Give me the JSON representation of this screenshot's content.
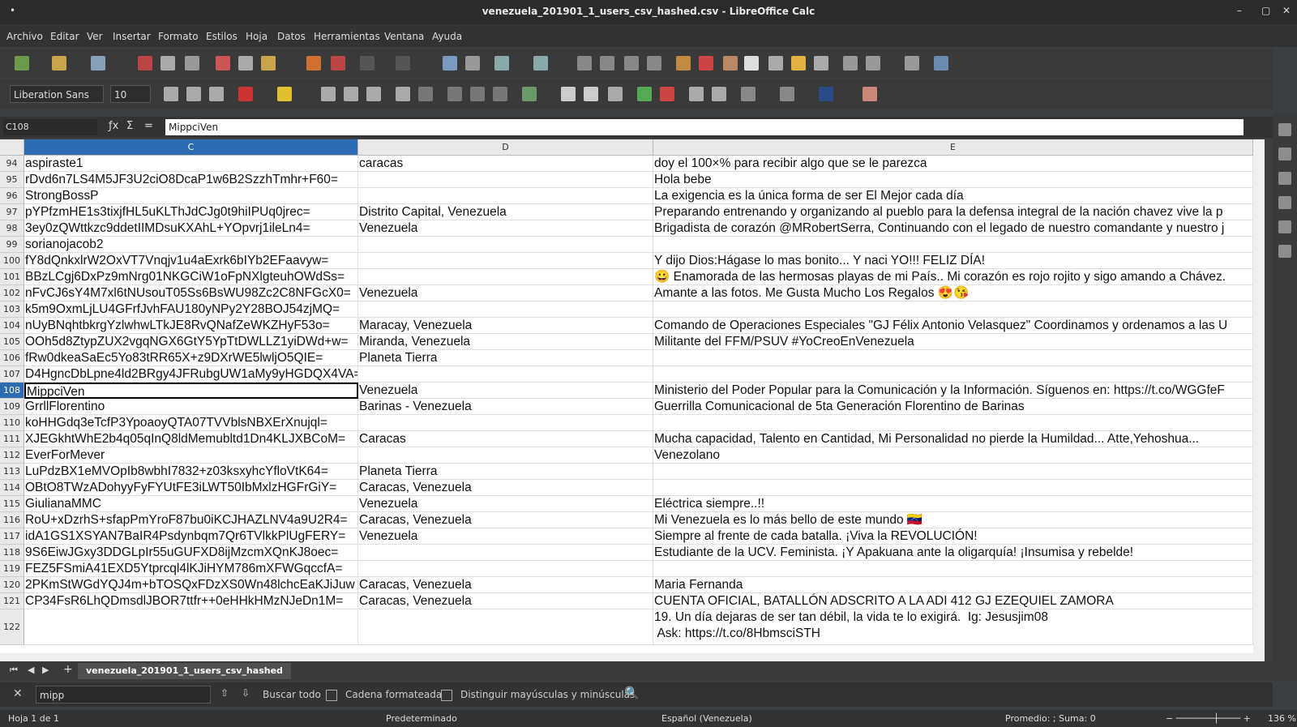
{
  "window": {
    "title": "venezuela_201901_1_users_csv_hashed.csv - LibreOffice Calc"
  },
  "menu": [
    "Archivo",
    "Editar",
    "Ver",
    "Insertar",
    "Formato",
    "Estilos",
    "Hoja",
    "Datos",
    "Herramientas",
    "Ventana",
    "Ayuda"
  ],
  "toolbar": {
    "font_name": "Liberation Sans",
    "font_size": "10"
  },
  "formula_bar": {
    "cell_ref": "C108",
    "content": "MippciVen"
  },
  "columns": {
    "c": "C",
    "d": "D",
    "e": "E"
  },
  "rows": [
    {
      "num": "94",
      "c": "aspiraste1",
      "d": "caracas",
      "e": "doy el 100×% para recibir algo que se le parezca"
    },
    {
      "num": "95",
      "c": "rDvd6n7LS4M5JF3U2ciO8DcaP1w6B2SzzhTmhr+F60=",
      "d": "",
      "e": "Hola bebe"
    },
    {
      "num": "96",
      "c": "StrongBossP",
      "d": "",
      "e": "La exigencia es la única forma de ser El Mejor cada día"
    },
    {
      "num": "97",
      "c": "pYPfzmHE1s3tixjfHL5uKLThJdCJg0t9hiIPUq0jrec=",
      "d": "Distrito Capital, Venezuela",
      "e": "Preparando entrenando y organizando al pueblo para la defensa integral de la nación chavez vive la p"
    },
    {
      "num": "98",
      "c": "3ey0zQWttkzc9ddetIIMDsuKXAhL+YOpvrj1ileLn4=",
      "d": "Venezuela",
      "e": "Brigadista de corazón @MRobertSerra, Continuando con el legado de nuestro comandante y nuestro j"
    },
    {
      "num": "99",
      "c": "sorianojacob2",
      "d": "",
      "e": ""
    },
    {
      "num": "100",
      "c": "fY8dQnkxlrW2OxVT7Vnqjv1u4aExrk6bIYb2EFaavyw=",
      "d": "",
      "e": "Y dijo Dios:Hágase lo mas bonito... Y naci YO!!! FELIZ DÍA!"
    },
    {
      "num": "101",
      "c": "BBzLCgj6DxPz9mNrg01NKGCiW1oFpNXlgteuhOWdSs=",
      "d": "",
      "e": "😀 Enamorada de las hermosas playas de mi País.. Mi corazón es rojo rojito y sigo amando a Chávez."
    },
    {
      "num": "102",
      "c": "nFvCJ6sY4M7xl6tNUsouT05Ss6BsWU98Zc2C8NFGcX0=",
      "d": "Venezuela",
      "e": "Amante a las fotos. Me Gusta Mucho Los Regalos 😍😘"
    },
    {
      "num": "103",
      "c": "k5m9OxmLjLU4GFrfJvhFAU180yNPy2Y28BOJ54zjMQ=",
      "d": "",
      "e": ""
    },
    {
      "num": "104",
      "c": "nUyBNqhtbkrgYzlwhwLTkJE8RvQNafZeWKZHyF53o=",
      "d": "Maracay, Venezuela",
      "e": "Comando de Operaciones Especiales \"GJ Félix Antonio Velasquez\" Coordinamos y ordenamos a las U"
    },
    {
      "num": "105",
      "c": "OOh5d8ZtypZUX2vgqNGX6GtY5YpTtDWLLZ1yiDWd+w=",
      "d": "Miranda, Venezuela",
      "e": "Militante del FFM/PSUV #YoCreoEnVenezuela"
    },
    {
      "num": "106",
      "c": "fRw0dkeaSaEc5Yo83tRR65X+z9DXrWE5lwljO5QIE=",
      "d": "Planeta Tierra",
      "e": ""
    },
    {
      "num": "107",
      "c": "D4HgncDbLpne4ld2BRgy4JFRubgUW1aMy9yHGDQX4VA=",
      "d": "",
      "e": ""
    },
    {
      "num": "108",
      "c": "MippciVen",
      "d": "Venezuela",
      "e": "Ministerio del Poder Popular para la Comunicación y la Información. Síguenos en: https://t.co/WGGfeF"
    },
    {
      "num": "109",
      "c": "GrrllFlorentino",
      "d": "Barinas - Venezuela",
      "e": "Guerrilla Comunicacional de 5ta Generación Florentino de Barinas"
    },
    {
      "num": "110",
      "c": "koHHGdq3eTcfP3YpoaoyQTA07TVVblsNBXErXnujql=",
      "d": "",
      "e": ""
    },
    {
      "num": "111",
      "c": "XJEGkhtWhE2b4q05qInQ8ldMemubltd1Dn4KLJXBCoM=",
      "d": "Caracas",
      "e": "Mucha capacidad, Talento en Cantidad, Mi Personalidad no pierde la Humildad... Atte,Yehoshua..."
    },
    {
      "num": "112",
      "c": "EverForMever",
      "d": "",
      "e": "Venezolano"
    },
    {
      "num": "113",
      "c": "LuPdzBX1eMVOpIb8wbhI7832+z03ksxyhcYfloVtK64=",
      "d": "Planeta Tierra",
      "e": ""
    },
    {
      "num": "114",
      "c": "OBtO8TWzADohyyFyFYUtFE3iLWT50IbMxlzHGFrGiY=",
      "d": "Caracas, Venezuela",
      "e": ""
    },
    {
      "num": "115",
      "c": "GiulianaMMC",
      "d": "Venezuela",
      "e": "Eléctrica siempre..!!"
    },
    {
      "num": "116",
      "c": "RoU+xDzrhS+sfapPmYroF87bu0iKCJHAZLNV4a9U2R4=",
      "d": "Caracas, Venezuela",
      "e": "Mi Venezuela es lo más bello de este mundo 🇻🇪"
    },
    {
      "num": "117",
      "c": "idA1GS1XSYAN7BaIR4Psdynbqm7Qr6TVlkkPlUgFERY=",
      "d": "Venezuela",
      "e": "Siempre al frente de cada batalla. ¡Viva la REVOLUCIÓN!"
    },
    {
      "num": "118",
      "c": "9S6EiwJGxy3DDGLpIr55uGUFXD8ijMzcmXQnKJ8oec=",
      "d": "",
      "e": "Estudiante de la UCV. Feminista. ¡Y Apakuana ante la oligarquía! ¡Insumisa y rebelde!"
    },
    {
      "num": "119",
      "c": "FEZ5FSmiA41EXD5Ytprcql4lKJiHYM786mXFWGqccfA=",
      "d": "",
      "e": ""
    },
    {
      "num": "120",
      "c": "2PKmStWGdYQJ4m+bTOSQxFDzXS0Wn48lchcEaKJiJuw",
      "d": "Caracas, Venezuela",
      "e": "Maria Fernanda"
    },
    {
      "num": "121",
      "c": "CP34FsR6LhQDmsdlJBOR7ttfr++0eHHkHMzNJeDn1M=",
      "d": "Caracas, Venezuela",
      "e": "CUENTA OFICIAL, BATALLÓN ADSCRITO A LA ADI 412 GJ EZEQUIEL ZAMORA"
    },
    {
      "num": "122",
      "c": "",
      "d": "",
      "e": "19. Un día dejaras de ser tan débil, la vida te lo exigirá.  Ig: Jesusjim08\n Ask: https://t.co/8HbmsciSTH"
    }
  ],
  "sheet_tab": "venezuela_201901_1_users_csv_hashed",
  "find": {
    "query": "mipp",
    "find_all": "Buscar todo",
    "formatted": "Cadena formateada",
    "match_case": "Distinguir mayúsculas y minúsculas"
  },
  "status": {
    "sheet": "Hoja 1 de 1",
    "style": "Predeterminado",
    "language": "Español (Venezuela)",
    "sum": "Promedio: ; Suma: 0",
    "zoom": "136 %"
  }
}
